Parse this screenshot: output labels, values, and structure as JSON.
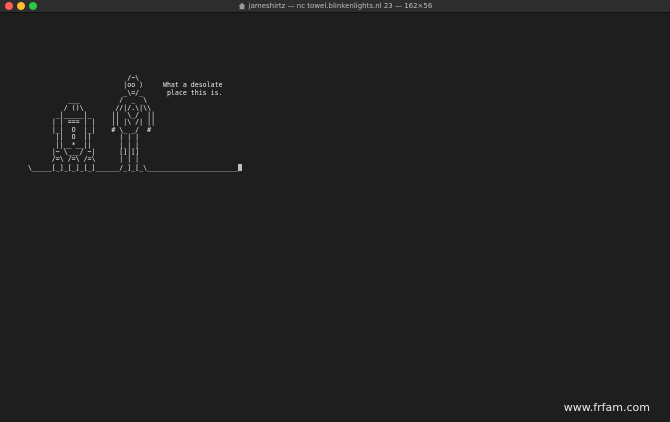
{
  "window": {
    "title": "jameshirtz — nc towel.blinkenlights.nl 23 — 162×56",
    "title_icon": "house-icon"
  },
  "colors": {
    "background": "#1e1e1e",
    "titlebar": "#2d2d2d",
    "text": "#ececec",
    "close": "#ff5f57",
    "minimize": "#febc2e",
    "maximize": "#28c840"
  },
  "terminal": {
    "art": "                         /~\\\n                        |oo )     What a desolate\n                        _\\=/_      place this is.\n          ___          /  _  \\\n         / ()\\        //|/.\\|\\\\\n       _|_____|_     ||  \\_/  ||\n      | | === | |    || |\\ /| ||\n      |_|  O  |_|    # \\_ _/  #\n       ||  O  ||       | | |\n       ||__*__||       | | |\n      |~ \\___/ ~|      []|[]\n      /=\\ /=\\ /=\\      | | |\n\\_____[_]_[_]_[_]______/_]_[_\\_______________________"
  },
  "watermark": "www.frfam.com"
}
